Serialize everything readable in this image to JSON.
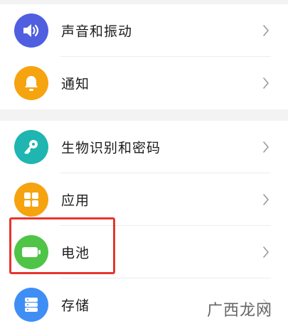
{
  "settings": {
    "groups": [
      {
        "items": [
          {
            "label": "声音和振动",
            "icon": "speaker-icon",
            "color": "#4f5fe0"
          },
          {
            "label": "通知",
            "icon": "bell-icon",
            "color": "#f5a30f"
          }
        ]
      },
      {
        "items": [
          {
            "label": "生物识别和密码",
            "icon": "key-icon",
            "color": "#1fb5b0"
          },
          {
            "label": "应用",
            "icon": "apps-grid-icon",
            "color": "#f5a30f"
          },
          {
            "label": "电池",
            "icon": "battery-icon",
            "color": "#4fc447"
          },
          {
            "label": "存储",
            "icon": "storage-icon",
            "color": "#3e8ef5"
          }
        ]
      }
    ],
    "highlight_color": "#e8352e"
  },
  "watermark": {
    "text": "广西龙网"
  }
}
